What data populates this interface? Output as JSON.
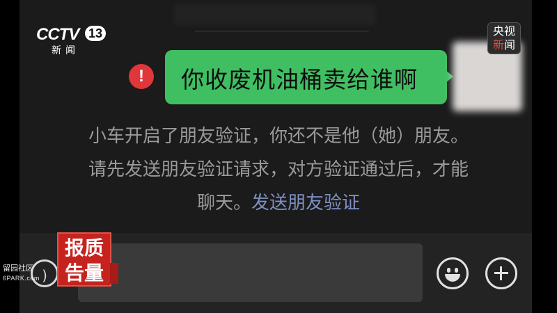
{
  "chat": {
    "outgoing_message": "你收废机油桶卖给谁啊",
    "error_mark": "!",
    "system_notice": {
      "line1": "小车开启了朋友验证，你还不是他（她）朋友。",
      "line2": "请先发送朋友验证请求，对方验证通过后，才能",
      "line3_prefix": "聊天。",
      "link": "发送朋友验证"
    }
  },
  "input_bar": {
    "voice_icon": "voice-icon",
    "emoji_icon": "emoji-icon",
    "plus_icon": "plus-icon"
  },
  "broadcast": {
    "channel_logo": "CCTV",
    "channel_number": "13",
    "channel_sub": "新闻",
    "badge_line1": "央视",
    "badge_line2_a": "新",
    "badge_line2_b": "闻",
    "stamp_line1": "报质",
    "stamp_line2": "告量",
    "watermark_line1": "留园社区",
    "watermark_line2": "6PARK.com"
  },
  "colors": {
    "bubble": "#3fbf62",
    "error": "#e0373b",
    "link": "#7e8fc4",
    "background": "#1b1b1b"
  }
}
